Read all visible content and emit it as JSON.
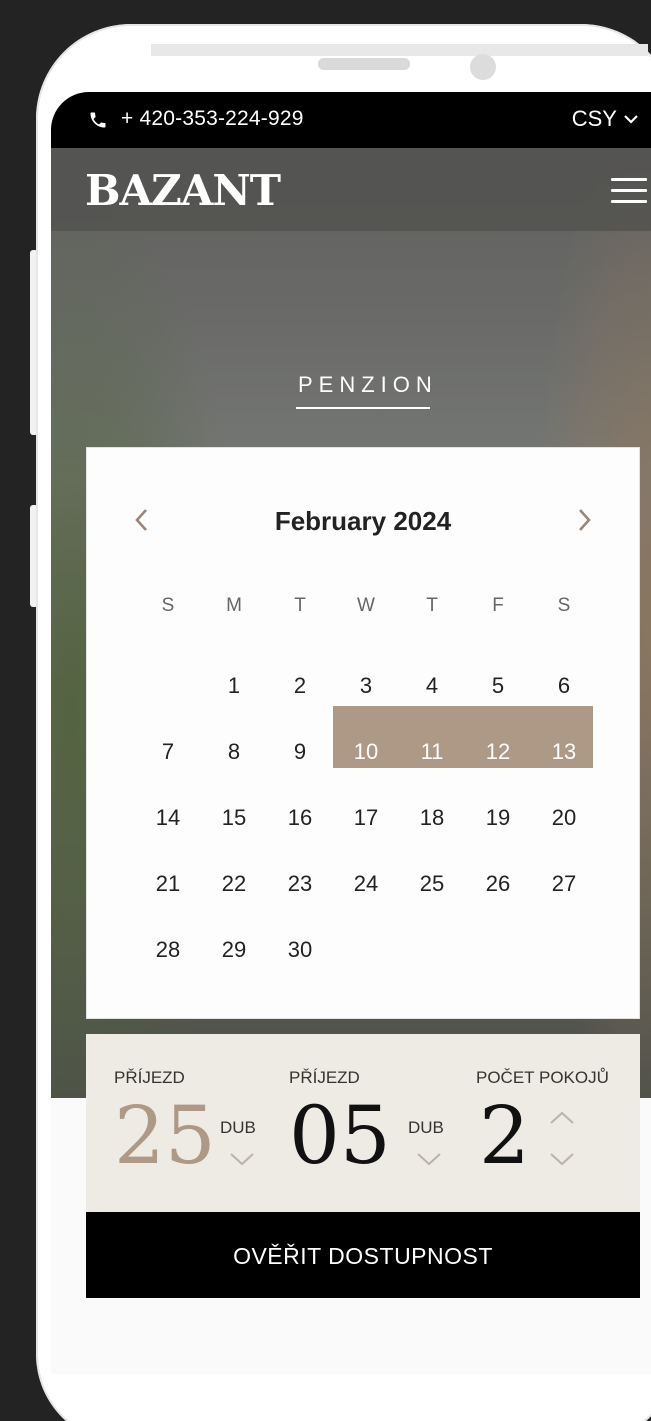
{
  "status_bar": {
    "phone_number": "+ 420-353-224-929",
    "language": "CSY"
  },
  "header": {
    "logo": "BAZANT"
  },
  "hero": {
    "section_label": "PENZION"
  },
  "calendar": {
    "month_title": "February 2024",
    "weekdays": [
      "S",
      "M",
      "T",
      "W",
      "T",
      "F",
      "S"
    ],
    "weeks": [
      [
        "",
        "1",
        "2",
        "3",
        "4",
        "5",
        "6"
      ],
      [
        "7",
        "8",
        "9",
        "10",
        "11",
        "12",
        "13"
      ],
      [
        "14",
        "15",
        "16",
        "17",
        "18",
        "19",
        "20"
      ],
      [
        "21",
        "22",
        "23",
        "24",
        "25",
        "26",
        "27"
      ],
      [
        "28",
        "29",
        "30",
        "",
        "",
        "",
        ""
      ]
    ],
    "selected_days": [
      "10",
      "11",
      "12",
      "13"
    ]
  },
  "booking": {
    "arrival_label": "PŘÍJEZD",
    "arrival_day": "25",
    "arrival_month": "DUB",
    "departure_label": "PŘÍJEZD",
    "departure_day": "05",
    "departure_month": "DUB",
    "rooms_label": "POČET POKOJŮ",
    "rooms_count": "2",
    "check_button": "OVĚŘIT DOSTUPNOST"
  },
  "colors": {
    "accent": "#ae9886",
    "booking_bg": "#eeebe4",
    "cta_bg": "#000000"
  }
}
